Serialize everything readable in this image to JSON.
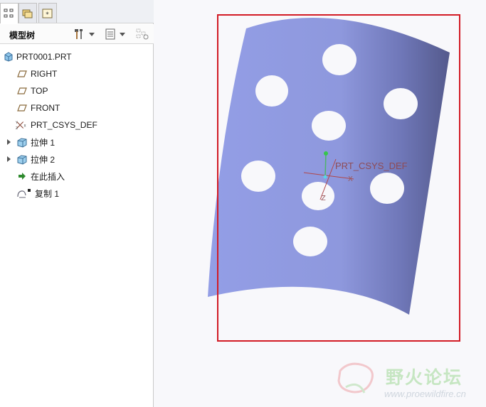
{
  "tabs": [
    {
      "name": "model-tree-tab",
      "icon": "tree-icon",
      "active": true
    },
    {
      "name": "folder-browser-tab",
      "icon": "folder-icon",
      "active": false
    },
    {
      "name": "favorites-tab",
      "icon": "favorites-icon",
      "active": false
    }
  ],
  "toolbar": {
    "title": "模型树",
    "settings_icon": "tools-icon",
    "show_icon": "list-icon",
    "filter_icon": "filter-icon"
  },
  "tree": {
    "items": [
      {
        "label": "PRT0001.PRT",
        "icon": "part-icon"
      },
      {
        "label": "RIGHT",
        "icon": "datum-plane-icon"
      },
      {
        "label": "TOP",
        "icon": "datum-plane-icon"
      },
      {
        "label": "FRONT",
        "icon": "datum-plane-icon"
      },
      {
        "label": "PRT_CSYS_DEF",
        "icon": "csys-icon"
      },
      {
        "label": "拉伸 1",
        "icon": "extrude-icon"
      },
      {
        "label": "拉伸 2",
        "icon": "extrude-icon"
      },
      {
        "label": "在此插入",
        "icon": "insert-here-icon"
      },
      {
        "label": "复制 1",
        "icon": "copy-feature-icon"
      }
    ]
  },
  "viewport": {
    "csys_label": "PRT_CSYS_DEF",
    "axis_x": "X",
    "axis_z": "Z",
    "surface_color": "#9aa3e4",
    "selection_color": "#d21b25"
  },
  "watermark": {
    "title": "野火论坛",
    "url": "www.proewildfire.cn"
  }
}
